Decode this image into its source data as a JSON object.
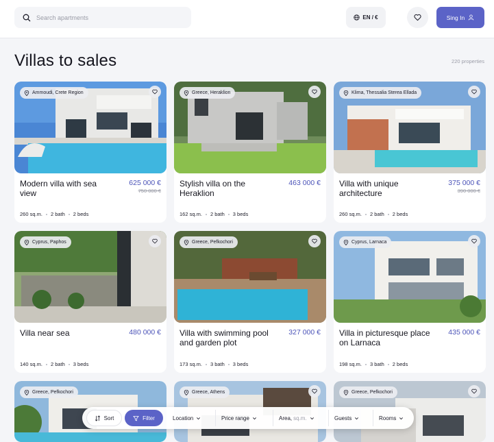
{
  "header": {
    "search_placeholder": "Search apartments",
    "language": "EN / €",
    "signin_label": "Sing In"
  },
  "page": {
    "title": "Villas to sales",
    "count": "220 properties"
  },
  "listings": [
    {
      "location": "Ammoudi, Crete Region",
      "name": "Modern villa with sea view",
      "price": "625 000 €",
      "old_price": "750 000 €",
      "area": "260 sq.m.",
      "bath": "2 bath",
      "beds": "2 beds"
    },
    {
      "location": "Greece, Heraklion",
      "name": "Stylish villa on the Heraklion",
      "price": "463 000 €",
      "old_price": "",
      "area": "162 sq.m.",
      "bath": "2 bath",
      "beds": "3 beds"
    },
    {
      "location": "Klima, Thessalia Sterea Ellada",
      "name": "Villa with unique architecture",
      "price": "375 000 €",
      "old_price": "390 000 €",
      "area": "260 sq.m.",
      "bath": "2 bath",
      "beds": "2 beds"
    },
    {
      "location": "Cyprus, Paphos",
      "name": "Villa near sea",
      "price": "480 000 €",
      "old_price": "",
      "area": "140 sq.m.",
      "bath": "2 bath",
      "beds": "3 beds"
    },
    {
      "location": "Greece, Pefkochori",
      "name": "Villa with swimming pool and garden plot",
      "price": "327 000 €",
      "old_price": "",
      "area": "173 sq.m.",
      "bath": "3 bath",
      "beds": "3 beds"
    },
    {
      "location": "Cyprus, Larnaca",
      "name": "Villa in picturesque place on Larnaca",
      "price": "435 000 €",
      "old_price": "",
      "area": "198 sq.m.",
      "bath": "3 bath",
      "beds": "2 beds"
    },
    {
      "location": "Greece, Pefkochori"
    },
    {
      "location": "Greece, Athens"
    },
    {
      "location": "Greece, Pefkochori"
    }
  ],
  "filters": {
    "sort": "Sort",
    "filter": "Filter",
    "location": "Location",
    "price_range": "Price range",
    "area": "Area,",
    "area_unit": "sq.m.",
    "guests": "Guests",
    "rooms": "Rooms"
  },
  "colors": {
    "accent": "#5b63c7",
    "price": "#4b53b8",
    "background": "#f4f5f8"
  },
  "icons": [
    "search-icon",
    "globe-icon",
    "heart-icon",
    "user-icon",
    "location-pin-icon",
    "sort-icon",
    "filter-icon",
    "chevron-down-icon"
  ]
}
